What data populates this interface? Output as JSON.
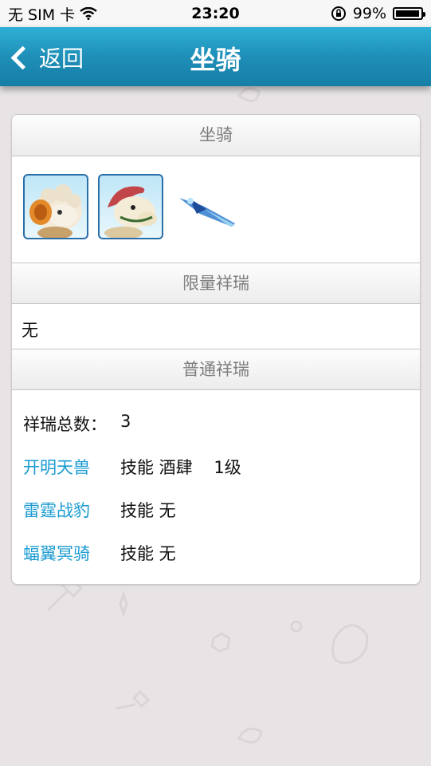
{
  "status": {
    "carrier": "无 SIM 卡",
    "time": "23:20",
    "battery": "99%"
  },
  "header": {
    "back_label": "返回",
    "title": "坐骑"
  },
  "sections": {
    "mounts_title": "坐骑",
    "limited_title": "限量祥瑞",
    "limited_value": "无",
    "normal_title": "普通祥瑞"
  },
  "normal": {
    "total_label": "祥瑞总数：",
    "total_value": "3",
    "items": [
      {
        "name": "开明天兽",
        "skill": "技能 酒肆    1级"
      },
      {
        "name": "雷霆战豹",
        "skill": "技能 无"
      },
      {
        "name": "蝠翼冥骑",
        "skill": "技能 无"
      }
    ]
  },
  "mounts": [
    "sheep-mount-icon",
    "horse-mount-icon",
    "blue-wing-mount-icon"
  ],
  "colors": {
    "header_blue": "#1e8fb8",
    "link_blue": "#1a9bd1",
    "background": "#e8e4e5"
  }
}
